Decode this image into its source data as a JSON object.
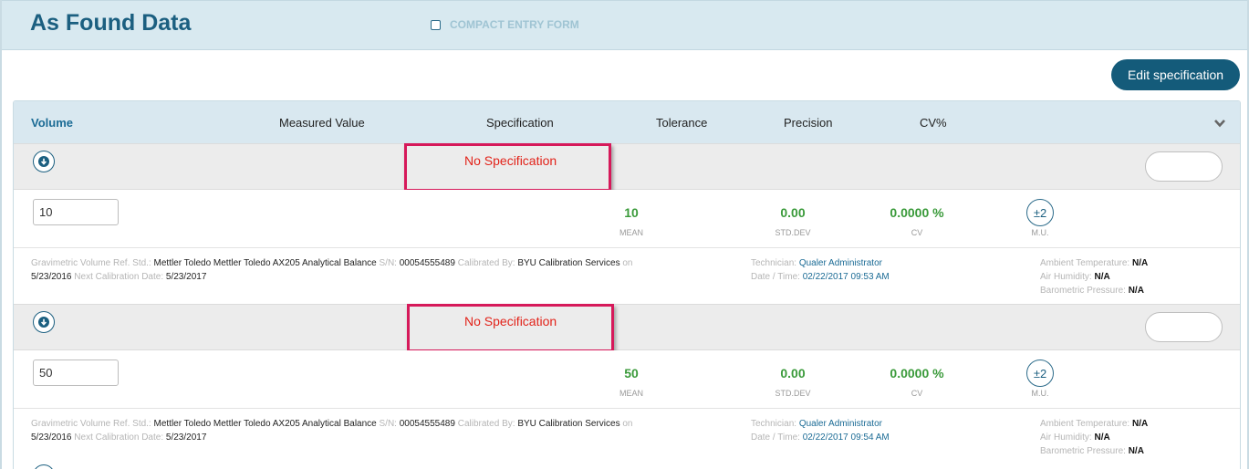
{
  "header": {
    "title": "As Found Data",
    "compact_label": "COMPACT ENTRY FORM"
  },
  "toolbar": {
    "edit_label": "Edit specification"
  },
  "columns": {
    "volume": "Volume",
    "measured": "Measured Value",
    "specification": "Specification",
    "tolerance": "Tolerance",
    "precision": "Precision",
    "cv": "CV%"
  },
  "rows": [
    {
      "spec_text": "No Specification",
      "input_value": "10",
      "mean": "10",
      "mean_label": "MEAN",
      "std": "0.00",
      "std_label": "STD.DEV",
      "cv": "0.0000 %",
      "cv_label": "CV",
      "mu": "±2",
      "mu_label": "M.U.",
      "ref_label": "Gravimetric Volume Ref. Std.:",
      "ref_value": "Mettler Toledo Mettler Toledo AX205 Analytical Balance",
      "sn_label": "S/N:",
      "sn_value": "00054555489",
      "calby_label": "Calibrated By:",
      "calby_value": "BYU Calibration Services",
      "on_label": "on",
      "cal_date": "5/23/2016",
      "next_label": "Next Calibration Date:",
      "next_date": "5/23/2017",
      "tech_label": "Technician:",
      "tech_value": "Qualer Administrator",
      "dt_label": "Date / Time:",
      "dt_value": "02/22/2017 09:53 AM",
      "amb_label": "Ambient Temperature:",
      "amb_value": "N/A",
      "hum_label": "Air Humidity:",
      "hum_value": "N/A",
      "baro_label": "Barometric Pressure:",
      "baro_value": "N/A"
    },
    {
      "spec_text": "No Specification",
      "input_value": "50",
      "mean": "50",
      "mean_label": "MEAN",
      "std": "0.00",
      "std_label": "STD.DEV",
      "cv": "0.0000 %",
      "cv_label": "CV",
      "mu": "±2",
      "mu_label": "M.U.",
      "ref_label": "Gravimetric Volume Ref. Std.:",
      "ref_value": "Mettler Toledo Mettler Toledo AX205 Analytical Balance",
      "sn_label": "S/N:",
      "sn_value": "00054555489",
      "calby_label": "Calibrated By:",
      "calby_value": "BYU Calibration Services",
      "on_label": "on",
      "cal_date": "5/23/2016",
      "next_label": "Next Calibration Date:",
      "next_date": "5/23/2017",
      "tech_label": "Technician:",
      "tech_value": "Qualer Administrator",
      "dt_label": "Date / Time:",
      "dt_value": "02/22/2017 09:54 AM",
      "amb_label": "Ambient Temperature:",
      "amb_value": "N/A",
      "hum_label": "Air Humidity:",
      "hum_value": "N/A",
      "baro_label": "Barometric Pressure:",
      "baro_value": "N/A"
    }
  ]
}
